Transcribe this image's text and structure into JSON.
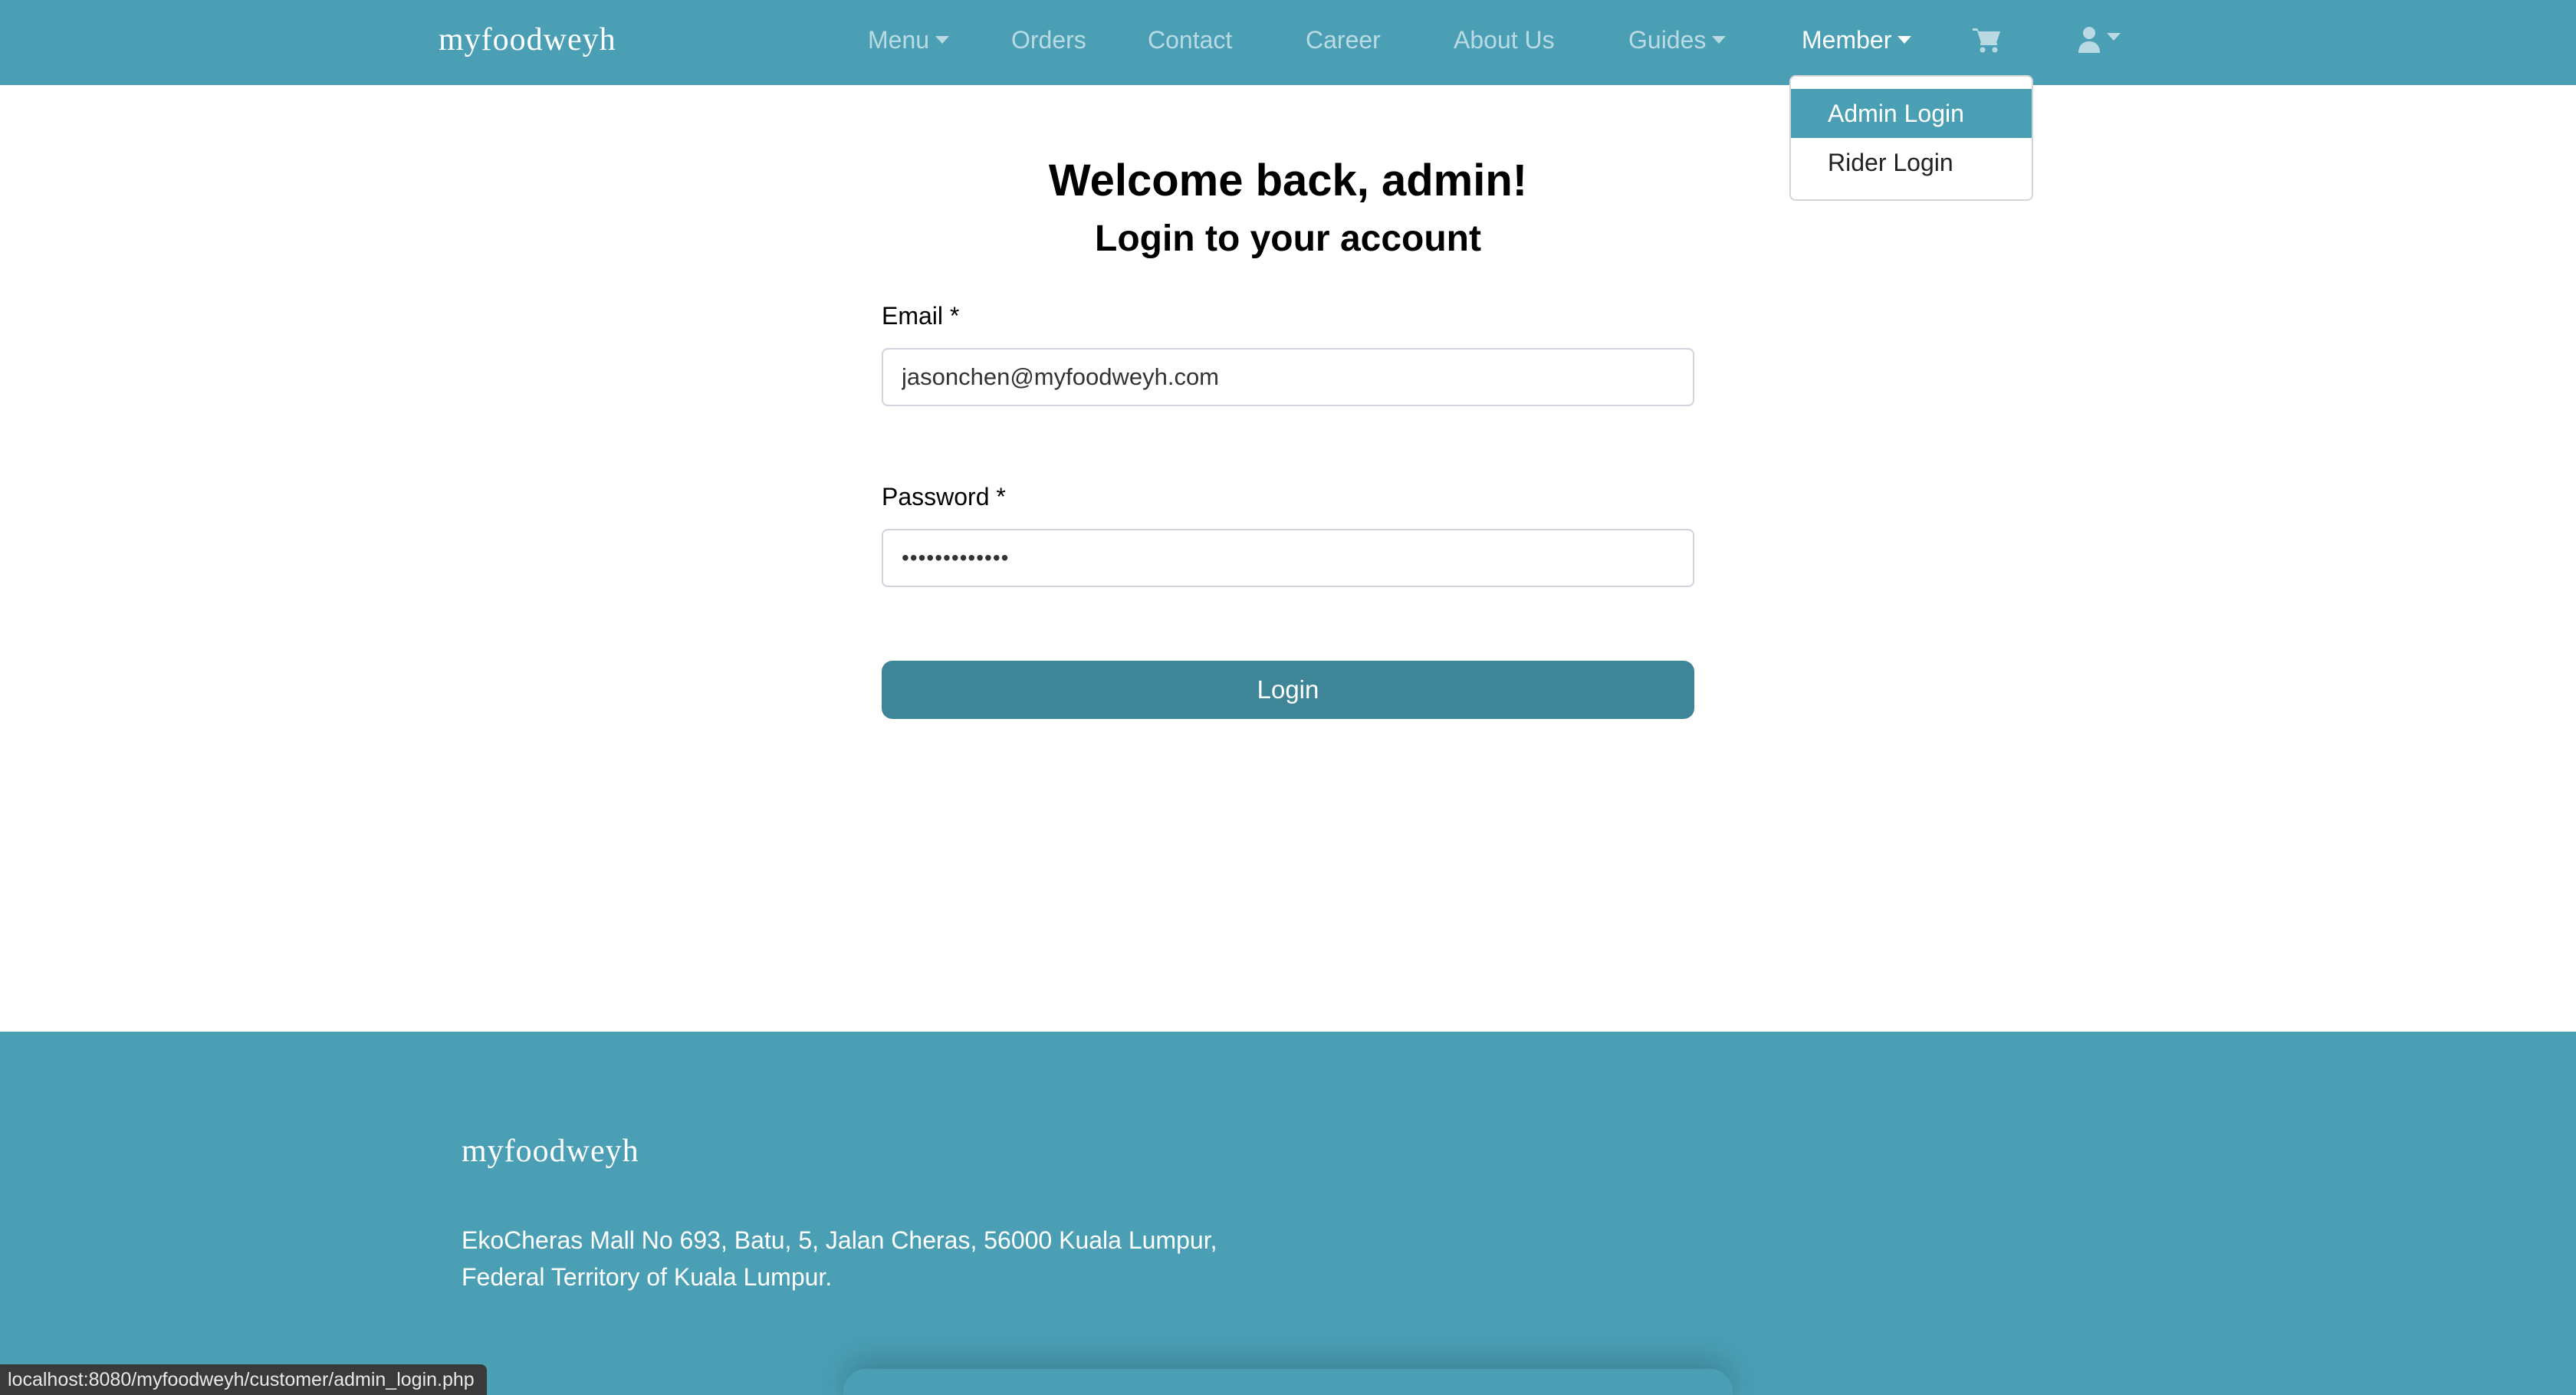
{
  "navbar": {
    "brand": "myfoodweyh",
    "items": [
      {
        "label": "Menu",
        "dropdown": true
      },
      {
        "label": "Orders"
      },
      {
        "label": "Contact"
      },
      {
        "label": "Career"
      },
      {
        "label": "About Us"
      },
      {
        "label": "Guides",
        "dropdown": true
      },
      {
        "label": "Member",
        "dropdown": true,
        "active": true
      }
    ],
    "icons": [
      "cart-icon",
      "user-icon"
    ]
  },
  "member_dropdown": {
    "items": [
      {
        "label": "Admin Login",
        "highlighted": true
      },
      {
        "label": "Rider Login"
      }
    ]
  },
  "login": {
    "title": "Welcome back, admin!",
    "subtitle": "Login to your account",
    "email_label": "Email *",
    "email_value": "jasonchen@myfoodweyh.com",
    "password_label": "Password *",
    "password_value": "•••••••••••••",
    "button_label": "Login"
  },
  "footer": {
    "brand": "myfoodweyh",
    "address_line1": "EkoCheras Mall No 693, Batu, 5, Jalan Cheras, 56000 Kuala Lumpur,",
    "address_line2": "Federal Territory of Kuala Lumpur."
  },
  "status_bar": {
    "url": "localhost:8080/myfoodweyh/customer/admin_login.php"
  },
  "colors": {
    "primary": "#4a9fb5",
    "button": "#3d8597",
    "nav_text_muted": "rgba(255,255,255,0.62)"
  }
}
